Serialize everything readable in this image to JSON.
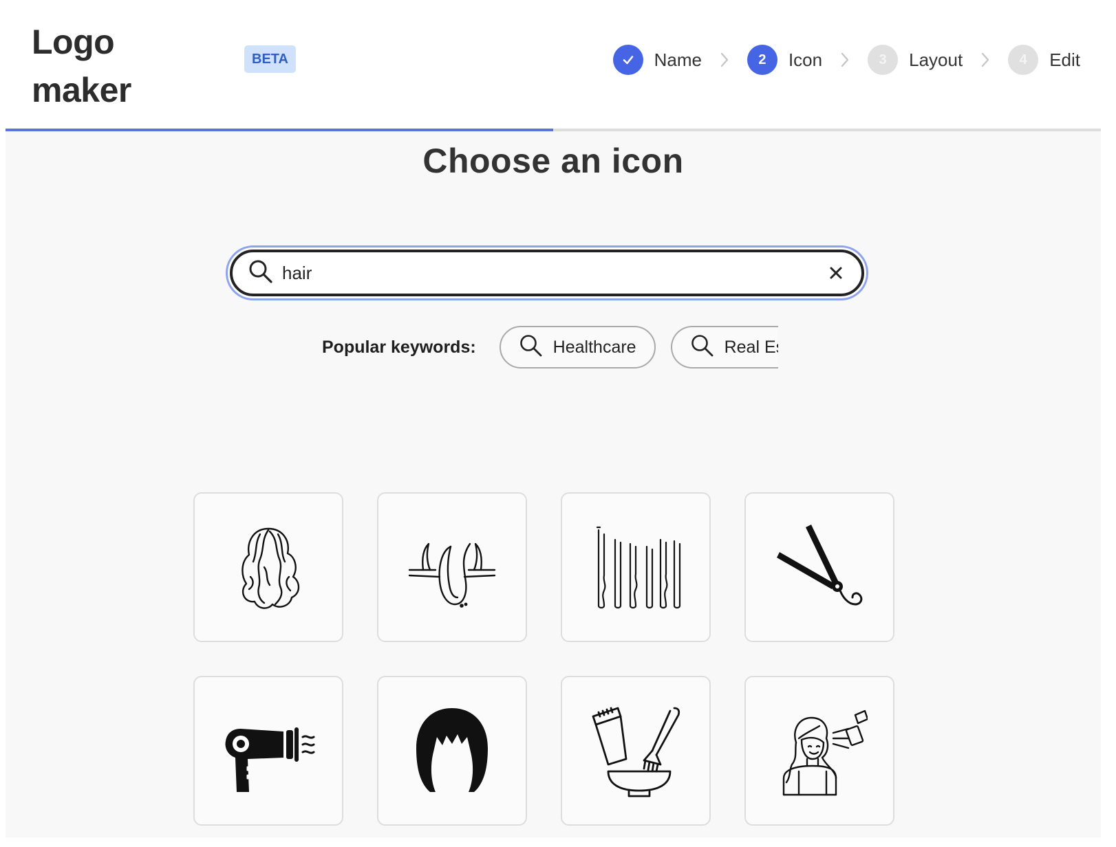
{
  "header": {
    "logo_text": "Logo maker",
    "badge": "BETA"
  },
  "steps": [
    {
      "number": "",
      "label": "Name",
      "state": "done"
    },
    {
      "number": "2",
      "label": "Icon",
      "state": "active"
    },
    {
      "number": "3",
      "label": "Layout",
      "state": "pending"
    },
    {
      "number": "4",
      "label": "Edit",
      "state": "pending"
    }
  ],
  "progress": {
    "fraction": 0.5
  },
  "main": {
    "heading": "Choose an icon",
    "search": {
      "value": "hair",
      "placeholder": ""
    },
    "keywords_label": "Popular keywords:",
    "keywords": [
      "Healthcare",
      "Real Es"
    ]
  },
  "icons": [
    {
      "name": "wavy-hair-icon"
    },
    {
      "name": "hair-follicle-icon"
    },
    {
      "name": "bobby-pins-icon"
    },
    {
      "name": "hair-straightener-icon"
    },
    {
      "name": "hair-dryer-icon"
    },
    {
      "name": "bob-haircut-icon"
    },
    {
      "name": "hair-dye-kit-icon"
    },
    {
      "name": "hair-spray-woman-icon"
    }
  ],
  "colors": {
    "accent": "#4565e4",
    "badge_bg": "#cfe1fb",
    "badge_text": "#2f5fbf",
    "progress": "#5b74d8"
  }
}
